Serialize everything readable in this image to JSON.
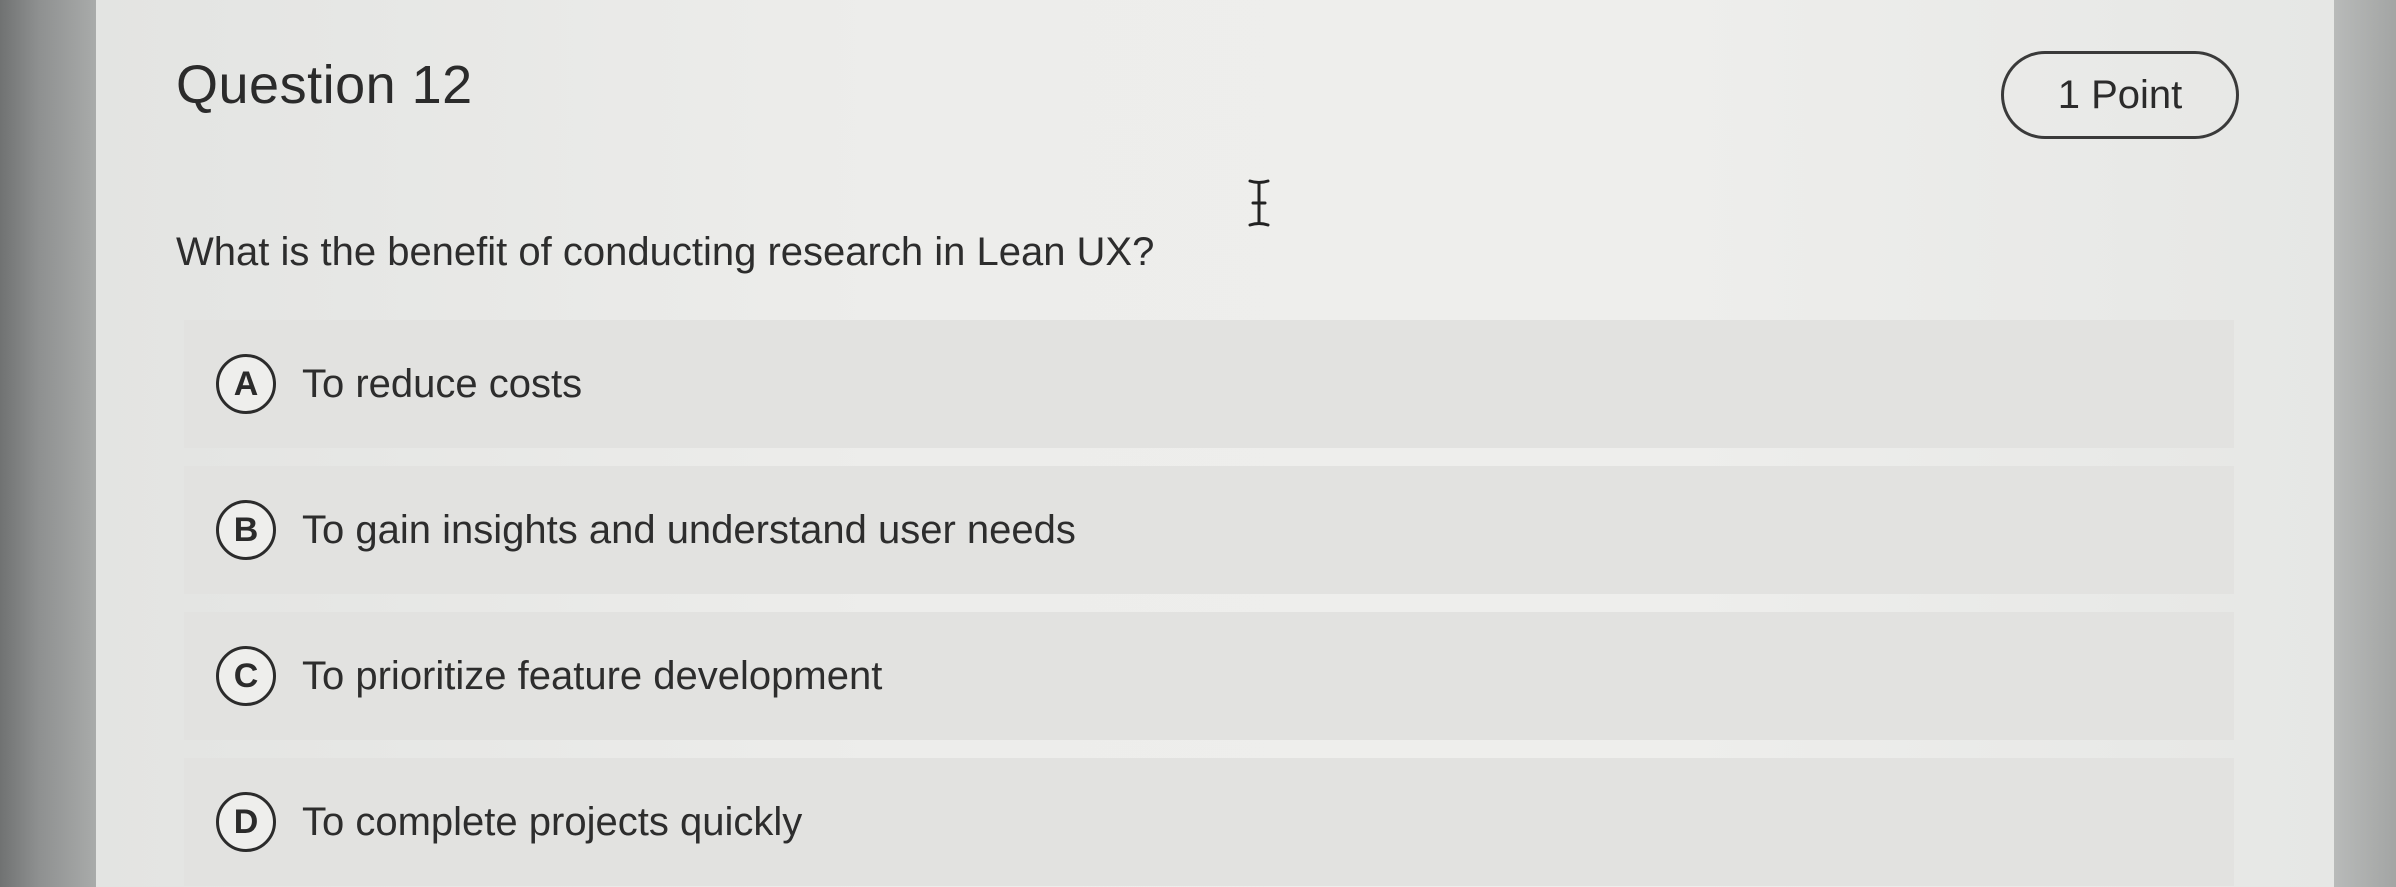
{
  "question": {
    "title": "Question 12",
    "points": "1 Point",
    "prompt": "What is the benefit of conducting research in Lean UX?"
  },
  "options": [
    {
      "letter": "A",
      "text": "To reduce costs"
    },
    {
      "letter": "B",
      "text": "To gain insights and understand user needs"
    },
    {
      "letter": "C",
      "text": "To prioritize feature development"
    },
    {
      "letter": "D",
      "text": "To complete projects quickly"
    }
  ],
  "cursor": {
    "icon": "text-cursor-icon"
  },
  "colors": {
    "text": "#2d2d2d",
    "option_background": "#e2e2e0",
    "page_background": "#eeeeec"
  }
}
